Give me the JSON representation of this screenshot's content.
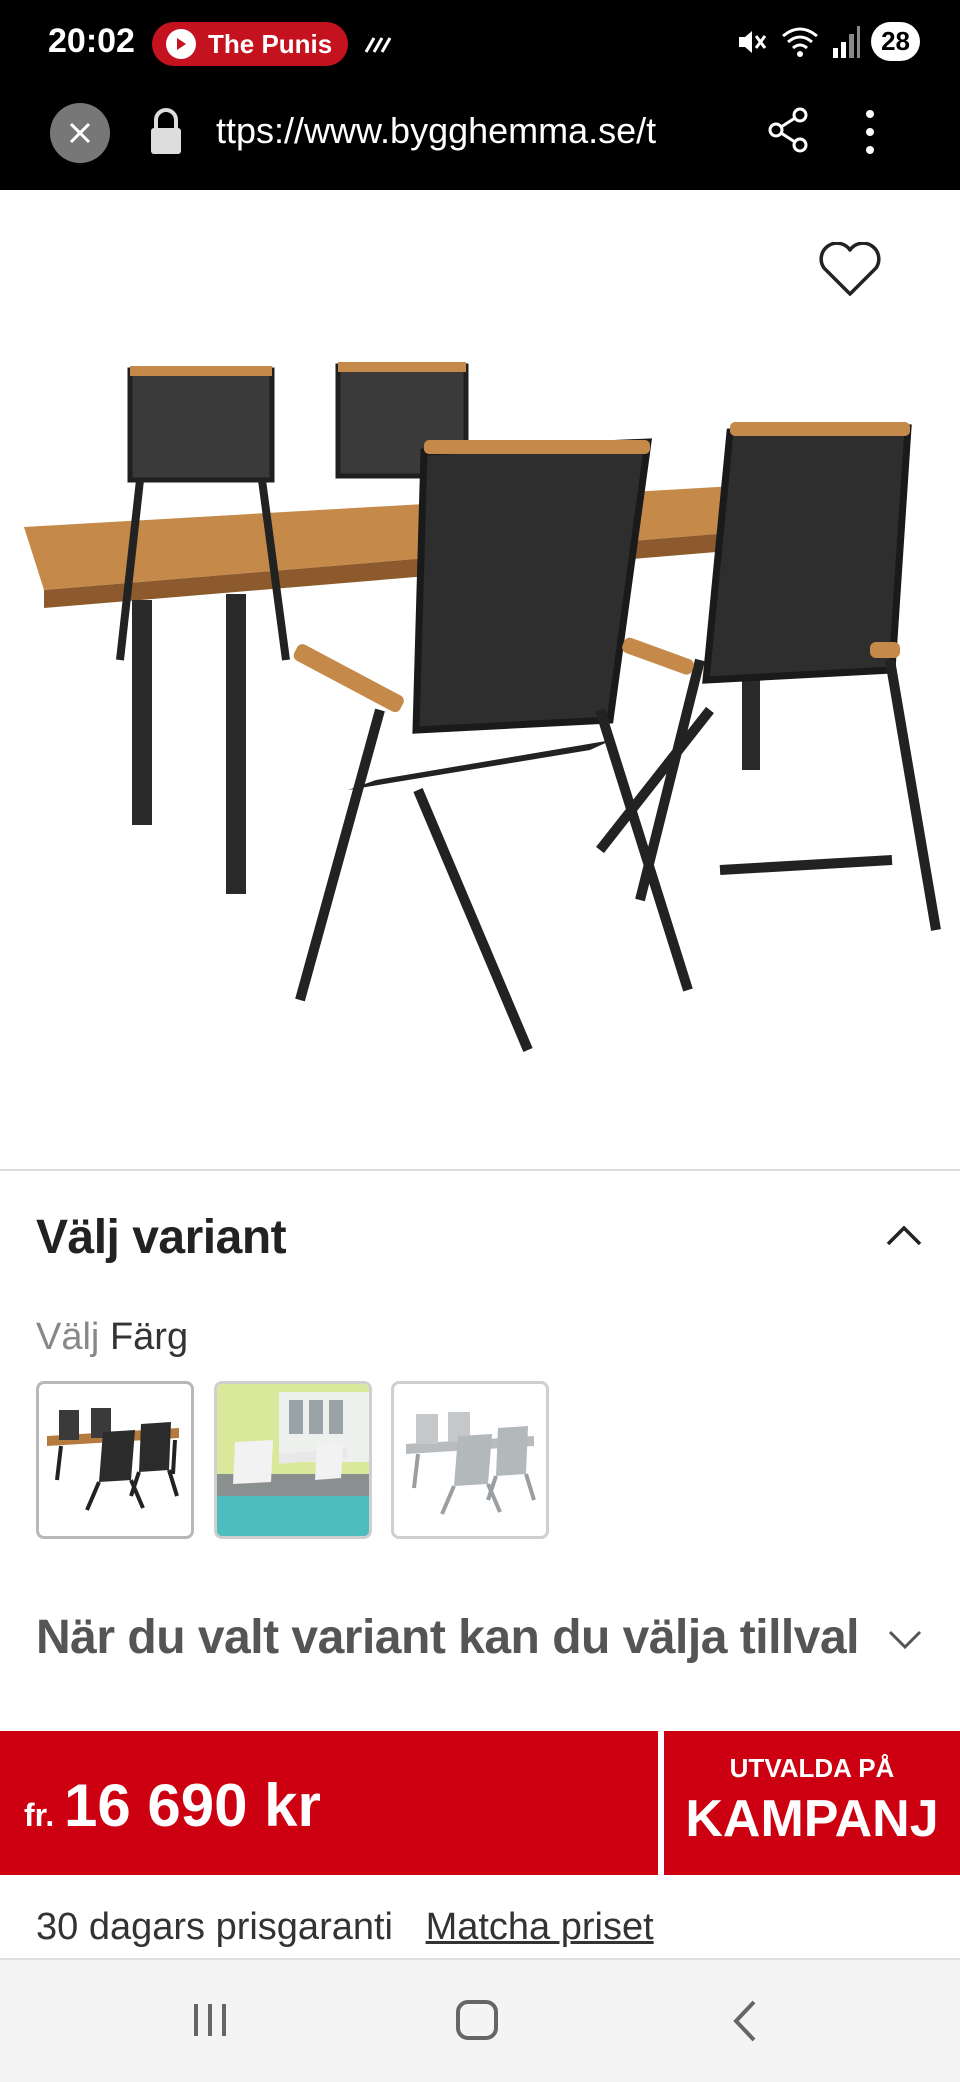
{
  "status_bar": {
    "time": "20:02",
    "media_title": "The Punis",
    "battery": "28",
    "icons": [
      "mute-icon",
      "wifi-icon",
      "signal-icon"
    ]
  },
  "url_bar": {
    "url": "ttps://www.bygghemma.se/t",
    "icons": [
      "close-icon",
      "lock-icon",
      "share-icon",
      "more-vert-icon"
    ]
  },
  "product": {
    "image_alt": "heart-icon"
  },
  "variant": {
    "title": "Välj variant",
    "color_prefix": "Välj",
    "color_name": "Färg",
    "swatches": [
      "black-set",
      "pool-white-set",
      "grey-set"
    ]
  },
  "addons": {
    "label": "När du valt variant kan du välja tillval"
  },
  "price": {
    "prefix": "fr.",
    "value": "16 690 kr",
    "campaign_line1": "UTVALDA PÅ",
    "campaign_line2": "KAMPANJ",
    "brand_color": "#cc0010"
  },
  "guarantee": {
    "text": "30 dagars prisgaranti",
    "link": "Matcha priset"
  },
  "navbar": {
    "icons": [
      "recent-apps-icon",
      "home-icon",
      "back-icon"
    ]
  }
}
